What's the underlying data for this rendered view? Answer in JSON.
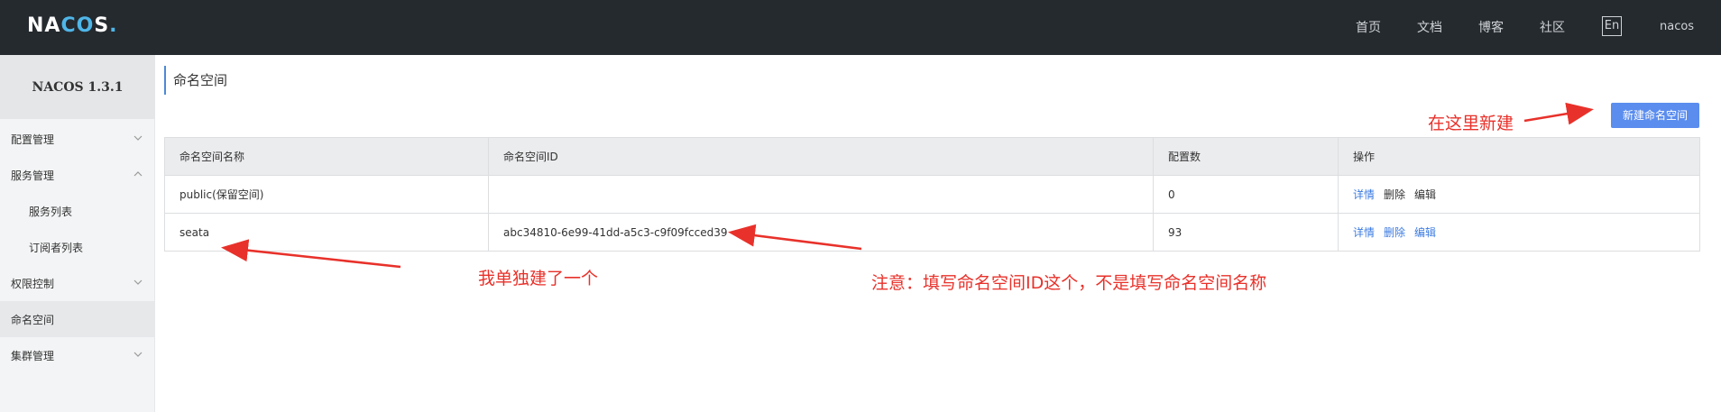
{
  "header": {
    "logo_main": "NA",
    "logo_accent": "CO",
    "logo_tail": "S",
    "logo_dot": ".",
    "nav": [
      "首页",
      "文档",
      "博客",
      "社区"
    ],
    "lang_button": "En",
    "user": "nacos"
  },
  "sidebar": {
    "title": "NACOS 1.3.1",
    "items": [
      {
        "label": "配置管理"
      },
      {
        "label": "服务管理"
      },
      {
        "label": "服务列表"
      },
      {
        "label": "订阅者列表"
      },
      {
        "label": "权限控制"
      },
      {
        "label": "命名空间"
      },
      {
        "label": "集群管理"
      }
    ]
  },
  "main": {
    "title": "命名空间",
    "new_button": "新建命名空间",
    "table": {
      "headers": [
        "命名空间名称",
        "命名空间ID",
        "配置数",
        "操作"
      ],
      "rows": [
        {
          "name": "public(保留空间)",
          "id": "",
          "count": "0",
          "actions": [
            "详情",
            "删除",
            "编辑"
          ]
        },
        {
          "name": "seata",
          "id": "abc34810-6e99-41dd-a5c3-c9f09fcced39",
          "count": "93",
          "actions": [
            "详情",
            "删除",
            "编辑"
          ]
        }
      ]
    }
  },
  "annotations": {
    "create_here": "在这里新建",
    "created_alone": "我单独建了一个",
    "note": "注意：填写命名空间ID这个，不是填写命名空间名称"
  },
  "colors": {
    "topbar": "#252a2f",
    "accent": "#4fb6e8",
    "primary_button": "#5b8def",
    "annotation": "#e8312a"
  }
}
